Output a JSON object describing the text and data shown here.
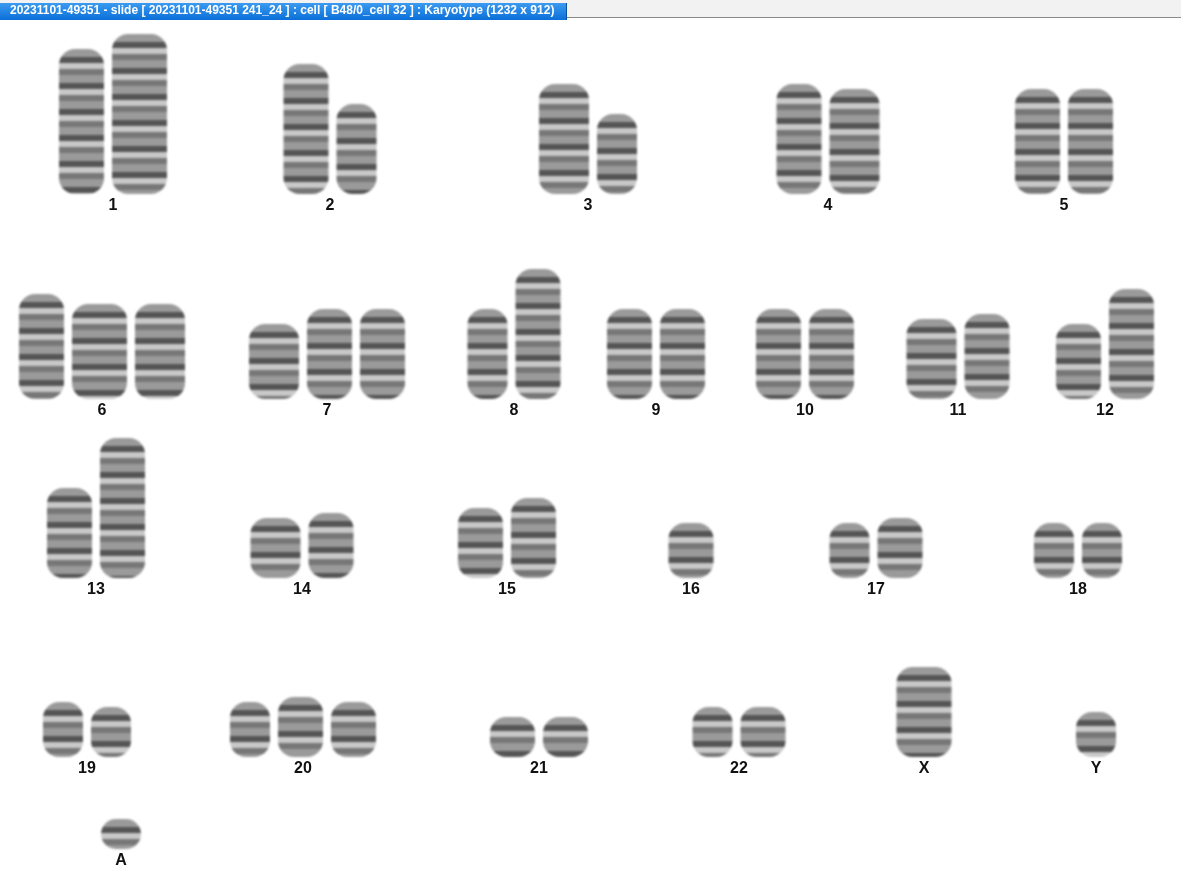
{
  "window": {
    "title": "20231101-49351  - slide [ 20231101-49351 241_24 ] : cell [ B48/0_cell 32 ] : Karyotype  (1232 x 912)"
  },
  "rows": [
    {
      "groups": [
        {
          "label": "1"
        },
        {
          "label": "2"
        },
        {
          "label": "3"
        },
        {
          "label": "4"
        },
        {
          "label": "5"
        }
      ]
    },
    {
      "groups": [
        {
          "label": "6"
        },
        {
          "label": "7"
        },
        {
          "label": "8"
        },
        {
          "label": "9"
        },
        {
          "label": "10"
        },
        {
          "label": "11"
        },
        {
          "label": "12"
        }
      ]
    },
    {
      "groups": [
        {
          "label": "13"
        },
        {
          "label": "14"
        },
        {
          "label": "15"
        },
        {
          "label": "16"
        },
        {
          "label": "17"
        },
        {
          "label": "18"
        }
      ]
    },
    {
      "groups": [
        {
          "label": "19"
        },
        {
          "label": "20"
        },
        {
          "label": "21"
        },
        {
          "label": "22"
        },
        {
          "label": "X"
        },
        {
          "label": "Y"
        }
      ]
    },
    {
      "groups": [
        {
          "label": "A"
        }
      ]
    }
  ]
}
